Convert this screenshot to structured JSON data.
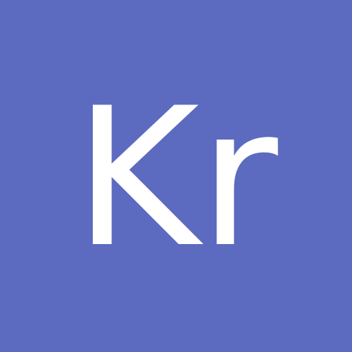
{
  "avatar": {
    "initials": "Kr",
    "background_color": "#5c6bc0",
    "text_color": "#ffffff"
  }
}
